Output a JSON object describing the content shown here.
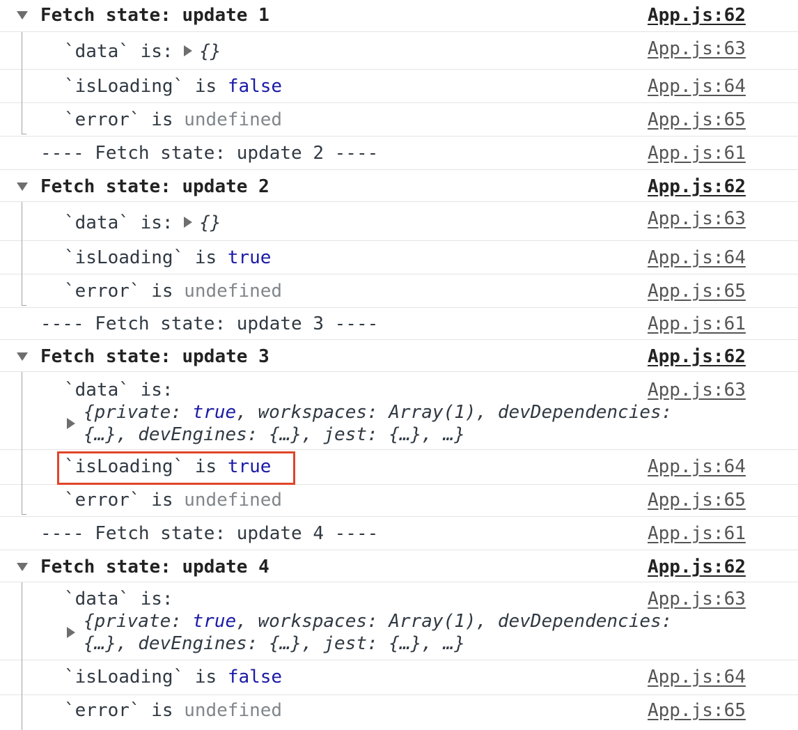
{
  "console": {
    "groups": [
      {
        "header": {
          "label": "Fetch state: update 1",
          "source": "App.js:62"
        },
        "data": {
          "label": "`data` is: ",
          "preview": "{}",
          "source": "App.js:63"
        },
        "loading": {
          "label": "`isLoading` is ",
          "value": "false",
          "source": "App.js:64"
        },
        "error": {
          "label": "`error` is ",
          "value": "undefined",
          "source": "App.js:65"
        }
      },
      {
        "separator": {
          "label": "---- Fetch state: update 2 ----",
          "source": "App.js:61"
        },
        "header": {
          "label": "Fetch state: update 2",
          "source": "App.js:62"
        },
        "data": {
          "label": "`data` is: ",
          "preview": "{}",
          "source": "App.js:63"
        },
        "loading": {
          "label": "`isLoading` is ",
          "value": "true",
          "source": "App.js:64"
        },
        "error": {
          "label": "`error` is ",
          "value": "undefined",
          "source": "App.js:65"
        }
      },
      {
        "separator": {
          "label": "---- Fetch state: update 3 ----",
          "source": "App.js:61"
        },
        "header": {
          "label": "Fetch state: update 3",
          "source": "App.js:62"
        },
        "data": {
          "label": "`data` is:",
          "preview_line1_a": "{private: ",
          "preview_line1_b": "true",
          "preview_line1_c": ", workspaces: Array(1), devDependencies:",
          "preview_line2": "{…}, devEngines: {…}, jest: {…}, …}",
          "source": "App.js:63"
        },
        "loading": {
          "label": "`isLoading` is ",
          "value": "true",
          "source": "App.js:64"
        },
        "error": {
          "label": "`error` is ",
          "value": "undefined",
          "source": "App.js:65"
        }
      },
      {
        "separator": {
          "label": "---- Fetch state: update 4 ----",
          "source": "App.js:61"
        },
        "header": {
          "label": "Fetch state: update 4",
          "source": "App.js:62"
        },
        "data": {
          "label": "`data` is:",
          "preview_line1_a": "{private: ",
          "preview_line1_b": "true",
          "preview_line1_c": ", workspaces: Array(1), devDependencies:",
          "preview_line2": "{…}, devEngines: {…}, jest: {…}, …}",
          "source": "App.js:63"
        },
        "loading": {
          "label": "`isLoading` is ",
          "value": "false",
          "source": "App.js:64"
        },
        "error": {
          "label": "`error` is ",
          "value": "undefined",
          "source": "App.js:65"
        }
      }
    ],
    "colors": {
      "keyword": "#1a1aa6",
      "undefined": "#80868b",
      "highlight": "#e0452a"
    }
  }
}
